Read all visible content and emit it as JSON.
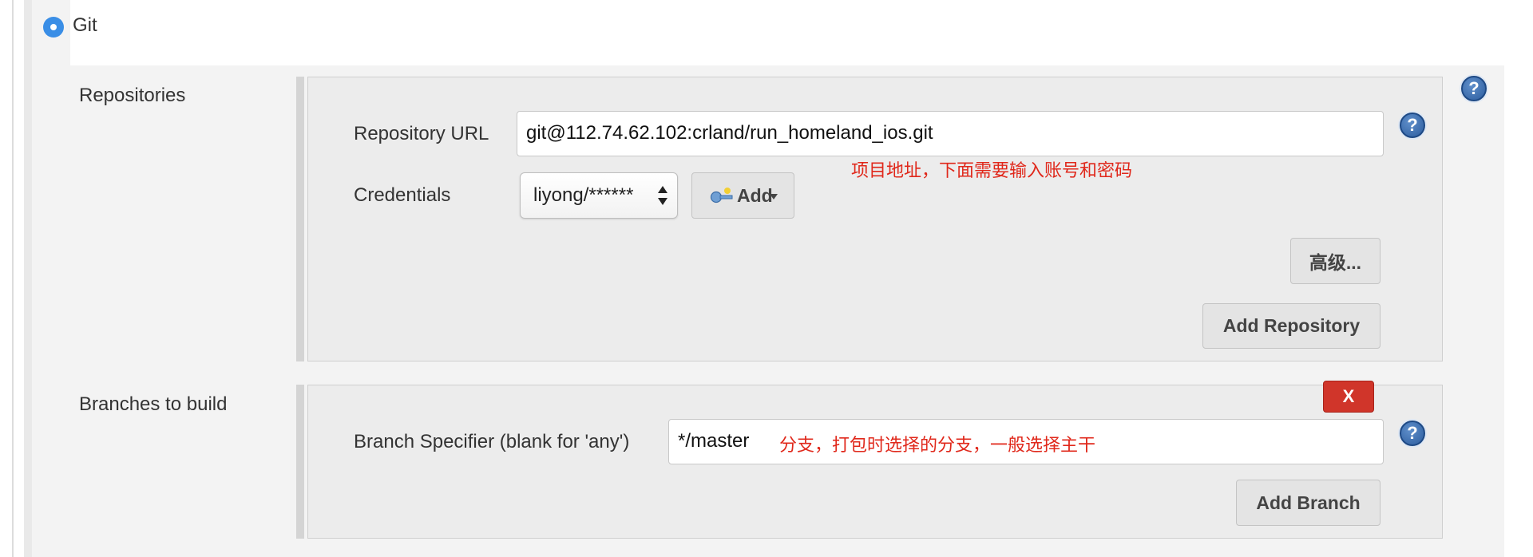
{
  "scm": {
    "label": "Git"
  },
  "repositories": {
    "section_label": "Repositories",
    "url_label": "Repository URL",
    "url_value": "git@112.74.62.102:crland/run_homeland_ios.git",
    "url_annotation": "项目地址，下面需要输入账号和密码",
    "credentials_label": "Credentials",
    "credentials_value": "liyong/******",
    "add_label": "Add",
    "advanced_label": "高级...",
    "add_repository_label": "Add Repository"
  },
  "branches": {
    "section_label": "Branches to build",
    "specifier_label": "Branch Specifier (blank for 'any')",
    "specifier_value": "*/master",
    "specifier_annotation": "分支，打包时选择的分支，一般选择主干",
    "delete_label": "X",
    "add_branch_label": "Add Branch"
  },
  "help": {
    "glyph": "?"
  },
  "colors": {
    "radio_selected": "#3a8ee6",
    "annotation": "#e0281b",
    "delete_button": "#d0352a",
    "help_icon": "#2d5d9e"
  },
  "icons": {
    "radio": "radio-selected-icon",
    "help": "help-icon",
    "credentials_add": "key-icon",
    "select_arrows": "updown-arrows-icon",
    "add_dropdown": "dropdown-arrow-icon"
  }
}
